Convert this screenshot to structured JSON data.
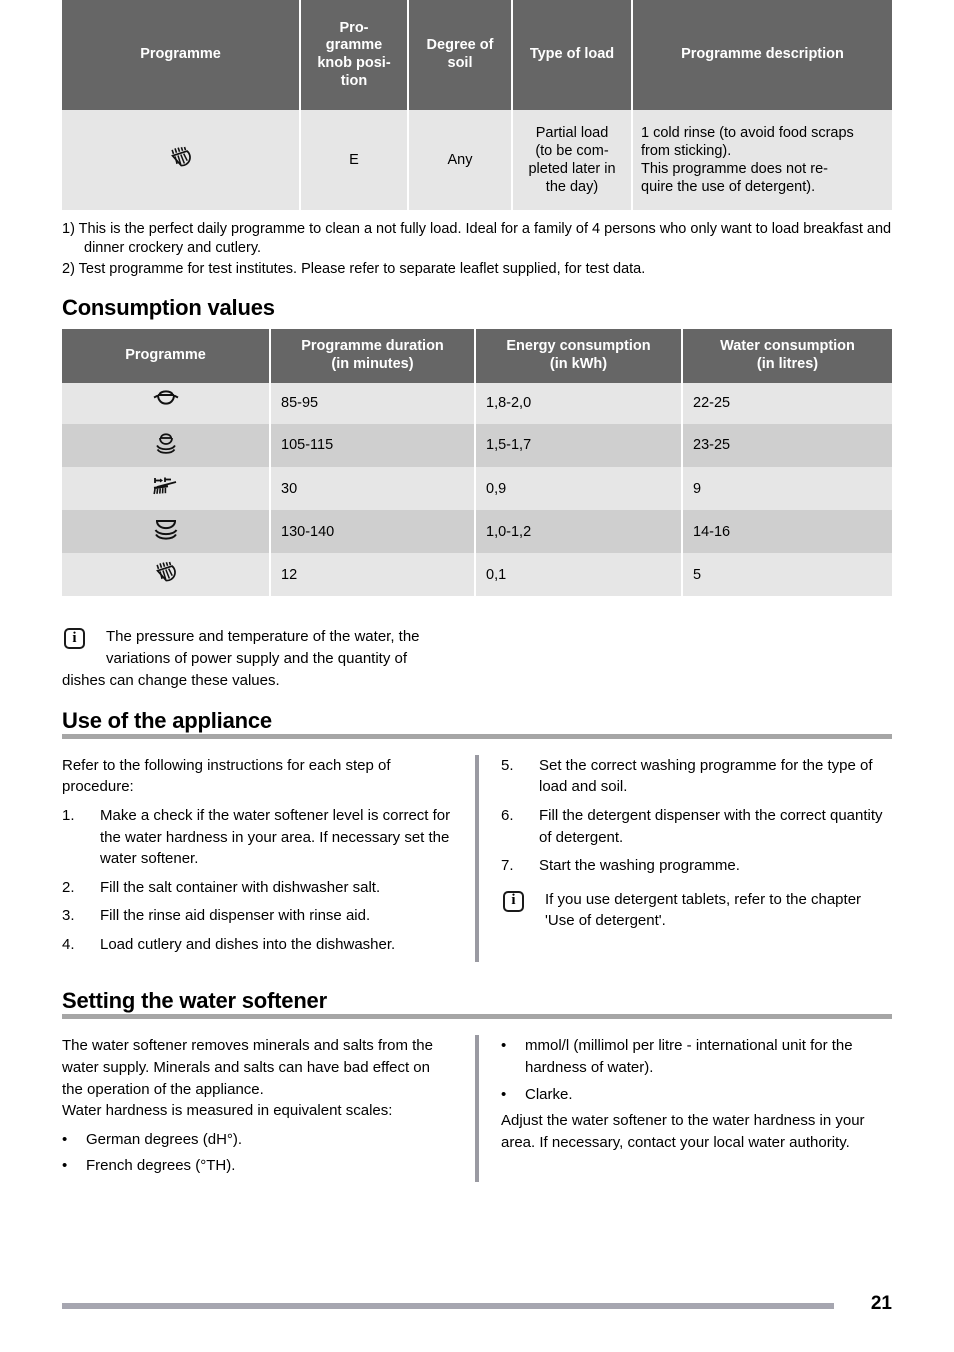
{
  "page": {
    "number": "21"
  },
  "programme_table": {
    "headers": [
      "Programme",
      "Pro-\ngramme\nknob posi-\ntion",
      "Degree of\nsoil",
      "Type of load",
      "Programme description"
    ],
    "headers_flat": [
      "Programme",
      "Programme knob position",
      "Degree of soil",
      "Type of load",
      "Programme description"
    ],
    "rows": [
      {
        "programme_icon": "rinse-spray-icon",
        "knob_position": "E",
        "degree_of_soil": "Any",
        "type_of_load": "Partial load (to be completed later in the day)",
        "description": "1 cold rinse (to avoid food scraps from sticking).\nThis programme does not require the use of detergent)."
      }
    ]
  },
  "footnotes": [
    "1) This is the perfect daily programme to clean a not fully load. Ideal for a family of 4 persons who only want to load breakfast and dinner crockery and cutlery.",
    "2) Test programme for test institutes. Please refer to separate leaflet supplied, for test data."
  ],
  "consumption": {
    "title": "Consumption values",
    "headers": [
      "Programme",
      "Programme duration\n(in minutes)",
      "Energy consumption\n(in kWh)",
      "Water consumption\n(in litres)"
    ],
    "headers_flat": [
      "Programme",
      "Programme duration (in minutes)",
      "Energy consumption (in kWh)",
      "Water consumption (in litres)"
    ],
    "rows": [
      {
        "icon": "pot-intensive-icon",
        "duration": "85-95",
        "energy": "1,8-2,0",
        "water": "22-25"
      },
      {
        "icon": "pot-plates-icon",
        "duration": "105-115",
        "energy": "1,5-1,7",
        "water": "23-25"
      },
      {
        "icon": "quick-wash-icon",
        "duration": "30",
        "energy": "0,9",
        "water": "9"
      },
      {
        "icon": "plates-stack-icon",
        "duration": "130-140",
        "energy": "1,0-1,2",
        "water": "14-16"
      },
      {
        "icon": "rinse-spray-icon",
        "duration": "12",
        "energy": "0,1",
        "water": "5"
      }
    ]
  },
  "consumption_note": {
    "icon": "info-icon",
    "line1": "The pressure and temperature of the water, the",
    "line2": "variations of power supply and the quantity of",
    "line3": "dishes can change these values."
  },
  "use_of_appliance": {
    "title": "Use of the appliance",
    "intro": "Refer to the following instructions for each step of procedure:",
    "steps_left": [
      {
        "num": "1.",
        "text": "Make a check if the water softener level is correct for the water hardness in your area. If necessary set the water softener."
      },
      {
        "num": "2.",
        "text": "Fill the salt container with dishwasher salt."
      },
      {
        "num": "3.",
        "text": "Fill the rinse aid dispenser with rinse aid."
      },
      {
        "num": "4.",
        "text": "Load cutlery and dishes into the dishwasher."
      }
    ],
    "steps_right": [
      {
        "num": "5.",
        "text": "Set the correct washing programme for the type of load and soil."
      },
      {
        "num": "6.",
        "text": "Fill the detergent dispenser with the correct quantity of detergent."
      },
      {
        "num": "7.",
        "text": "Start the washing programme."
      }
    ],
    "note": {
      "icon": "info-icon",
      "text": "If you use detergent tablets, refer to the chapter 'Use of detergent'."
    }
  },
  "water_softener": {
    "title": "Setting the water softener",
    "intro1": "The water softener removes minerals and salts from the water supply. Minerals and salts can have bad effect on the operation of the appliance.",
    "intro2": "Water hardness is measured in equivalent scales:",
    "scales_left": [
      {
        "dot": "•",
        "text": "German degrees (dH°)."
      },
      {
        "dot": "•",
        "text": "French degrees (°TH)."
      }
    ],
    "scales_right": [
      {
        "dot": "•",
        "text": "mmol/l (millimol per litre - international unit for the hardness of water)."
      },
      {
        "dot": "•",
        "text": "Clarke."
      }
    ],
    "closing": "Adjust the water softener to the water hardness in your area. If necessary, contact your local water authority."
  },
  "colors": {
    "table_header_bg": "#666666",
    "row_light": "#e6e6e6",
    "row_dark": "#cfcfcf",
    "rule_gray": "#a6a6a6",
    "divider_gray": "#9a9aa2",
    "text": "#000000"
  }
}
